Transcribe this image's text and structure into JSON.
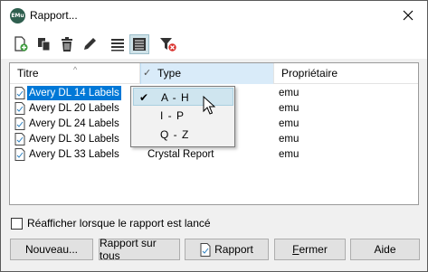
{
  "window": {
    "title": "Rapport...",
    "app_icon_text": "EMu"
  },
  "toolbar": {
    "buttons": [
      {
        "name": "new-report-icon"
      },
      {
        "name": "copy-report-icon"
      },
      {
        "name": "delete-icon"
      },
      {
        "name": "edit-pencil-icon"
      },
      {
        "name": "list-view-icon"
      },
      {
        "name": "detail-view-icon",
        "active": true
      },
      {
        "name": "clear-filter-icon"
      }
    ]
  },
  "list": {
    "columns": [
      "Titre",
      "Type",
      "Propriétaire"
    ],
    "rows": [
      {
        "title": "Avery DL 14 Labels",
        "type": "",
        "owner": "emu",
        "selected": true
      },
      {
        "title": "Avery DL 20 Labels",
        "type": "",
        "owner": "emu"
      },
      {
        "title": "Avery DL 24 Labels",
        "type": "",
        "owner": "emu"
      },
      {
        "title": "Avery DL 30 Labels",
        "type": "",
        "owner": "emu"
      },
      {
        "title": "Avery DL 33 Labels",
        "type": "Crystal Report",
        "owner": "emu"
      }
    ]
  },
  "filter_menu": {
    "items": [
      {
        "label": "A - H",
        "checked": true,
        "highlighted": true
      },
      {
        "label": "I - P",
        "checked": false
      },
      {
        "label": "Q - Z",
        "checked": false
      }
    ]
  },
  "options": {
    "redisplay_label": "Réafficher lorsque le rapport est lancé",
    "redisplay_checked": false
  },
  "buttons": {
    "new": "Nouveau...",
    "report_all": "Rapport sur tous",
    "report": "Rapport",
    "close_first": "F",
    "close_rest": "ermer",
    "help": "Aide"
  },
  "colors": {
    "selection": "#0078d7",
    "menu_highlight": "#cfe5ef",
    "column_active": "#d9ebf9"
  }
}
